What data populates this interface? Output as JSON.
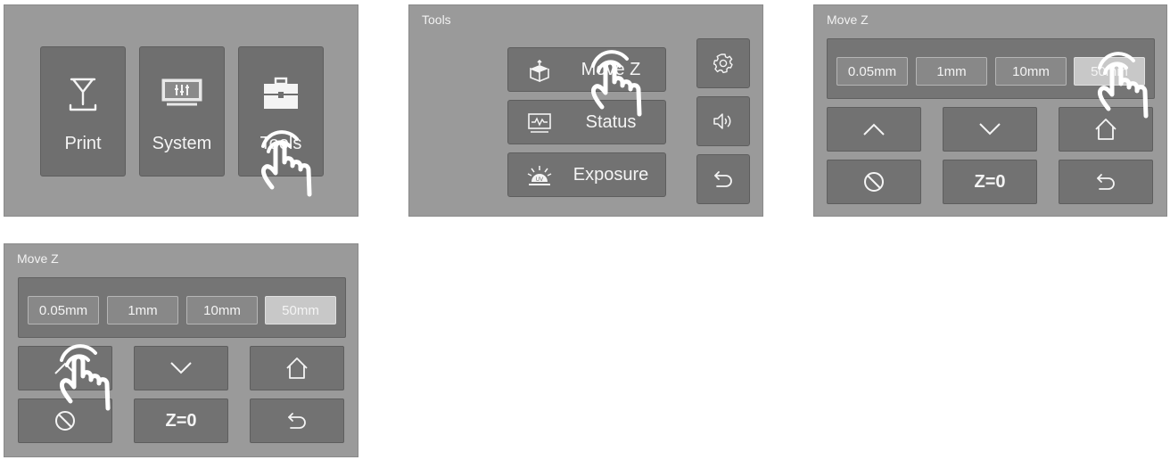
{
  "screen1": {
    "tiles": [
      {
        "label": "Print",
        "icon": "print-icon"
      },
      {
        "label": "System",
        "icon": "system-icon"
      },
      {
        "label": "Tools",
        "icon": "toolbox-icon"
      }
    ]
  },
  "screen2": {
    "title": "Tools",
    "menu": [
      {
        "label": "Move Z",
        "icon": "box-move-icon"
      },
      {
        "label": "Status",
        "icon": "monitor-wave-icon"
      },
      {
        "label": "Exposure",
        "icon": "uv-lamp-icon"
      }
    ],
    "side": [
      "gear-icon",
      "speaker-icon",
      "back-icon"
    ]
  },
  "screen3": {
    "title": "Move Z",
    "steps": [
      "0.05mm",
      "1mm",
      "10mm",
      "50mm"
    ],
    "selected_step": "50mm",
    "zero_label": "Z=0"
  },
  "screen4": {
    "title": "Move Z",
    "steps": [
      "0.05mm",
      "1mm",
      "10mm",
      "50mm"
    ],
    "selected_step": "50mm",
    "zero_label": "Z=0"
  },
  "colors": {
    "screen_bg": "#9a9a9a",
    "button_bg": "#727272",
    "selected_step": "#c8c8c8",
    "text": "#f4f4f4"
  }
}
